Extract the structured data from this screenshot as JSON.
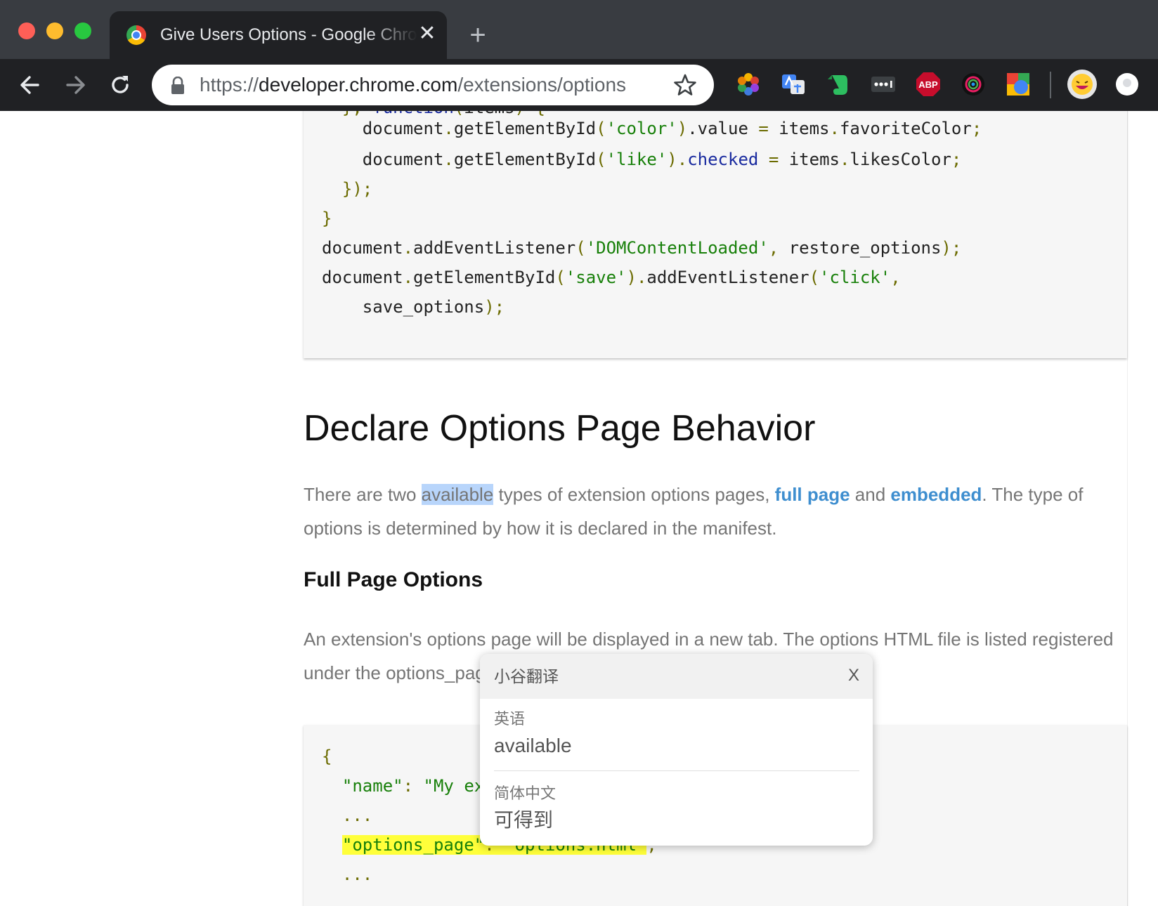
{
  "browser": {
    "tab": {
      "title": "Give Users Options - Google Chrome Developers",
      "close_label": "✕"
    },
    "new_tab_label": "+",
    "url": {
      "scheme": "https://",
      "host": "developer.chrome.com",
      "path": "/extensions/options"
    }
  },
  "page": {
    "code_top": [
      "  }, function(items) {",
      "    document.getElementById('color').value = items.favoriteColor;",
      "    document.getElementById('like').checked = items.likesColor;",
      "  });",
      "}",
      "document.addEventListener('DOMContentLoaded', restore_options);",
      "document.getElementById('save').addEventListener('click',",
      "    save_options);"
    ],
    "heading": "Declare Options Page Behavior",
    "para1": {
      "before": "There are two ",
      "highlight": "available",
      "middle": " types of extension options pages, ",
      "link1": "full page",
      "and": " and ",
      "link2": "embedded",
      "after": ". The type of options is determined by how it is declared in the manifest."
    },
    "subheading": "Full Page Options",
    "para2": "An extension's options page will be displayed in a new tab. The options HTML file is listed registered under the options_page field.",
    "code_bottom": [
      "{",
      "  \"name\": \"My extension\",",
      "  ...",
      "  \"options_page\": \"options.html\",",
      "  ..."
    ]
  },
  "translate_popup": {
    "title": "小谷翻译",
    "close_label": "X",
    "source_lang": "英语",
    "source_text": "available",
    "target_lang": "简体中文",
    "target_text": "可得到"
  }
}
